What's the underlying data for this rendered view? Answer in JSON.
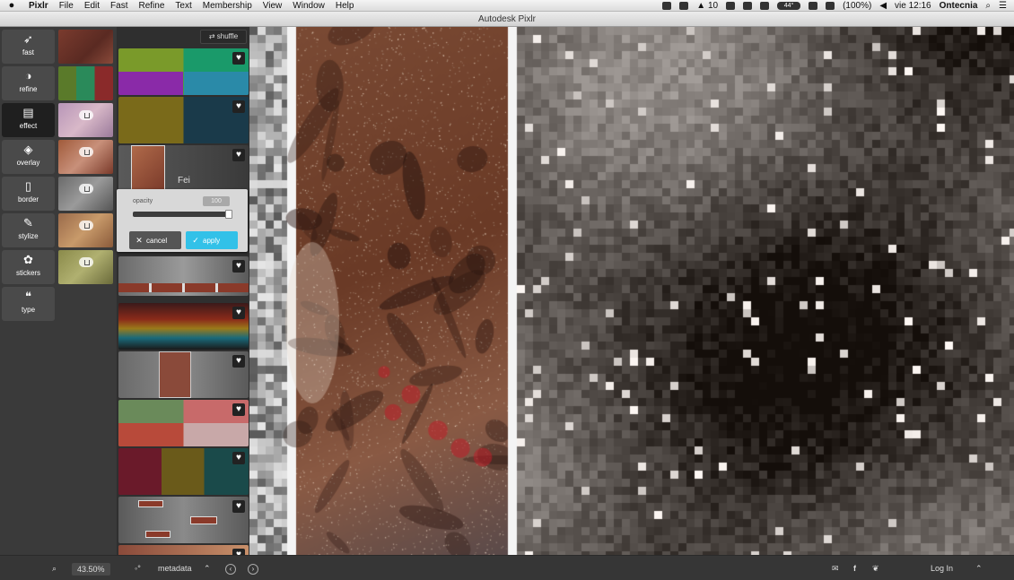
{
  "menubar": {
    "apple_icon": "apple-icon",
    "app": "Pixlr",
    "items": [
      "File",
      "Edit",
      "Fast",
      "Refine",
      "Text",
      "Membership",
      "View",
      "Window",
      "Help"
    ],
    "tray": {
      "signal": "10",
      "temp": "44°",
      "battery": "(100%)",
      "clock": "vie 12:16",
      "user": "Ontecnia"
    }
  },
  "window": {
    "title": "Autodesk Pixlr"
  },
  "tools": [
    {
      "label": "fast",
      "icon": "rocket-icon",
      "glyph": "➶"
    },
    {
      "label": "refine",
      "icon": "refine-icon",
      "glyph": "◑"
    },
    {
      "label": "effect",
      "icon": "film-icon",
      "glyph": "▤"
    },
    {
      "label": "overlay",
      "icon": "layers-icon",
      "glyph": "◈"
    },
    {
      "label": "border",
      "icon": "frame-icon",
      "glyph": "▯"
    },
    {
      "label": "stylize",
      "icon": "brush-icon",
      "glyph": "✎"
    },
    {
      "label": "stickers",
      "icon": "sticker-icon",
      "glyph": "✿"
    },
    {
      "label": "type",
      "icon": "quote-icon",
      "glyph": "❝"
    }
  ],
  "effects": {
    "shuffle_label": "shuffle",
    "shuffle_icon": "shuffle-icon",
    "heart_icon": "heart-icon",
    "selected_label": "Fei"
  },
  "opacity_popup": {
    "label": "opacity",
    "value": "100",
    "level": 1.0,
    "cancel_label": "cancel",
    "apply_label": "apply",
    "cancel_icon": "close-icon",
    "apply_icon": "check-icon"
  },
  "status": {
    "zoom": "43.50%",
    "metadata_label": "metadata",
    "login_label": "Log In",
    "icons": [
      "zoom-icon",
      "metadata-icon",
      "chevron-up-icon",
      "prev-icon",
      "next-icon",
      "mail-icon",
      "facebook-icon",
      "twitter-icon",
      "chevron-up-icon"
    ]
  },
  "colors": {
    "accent": "#32c1e8",
    "panel": "#3a3a3a",
    "active_tool": "#1f1f1f"
  }
}
